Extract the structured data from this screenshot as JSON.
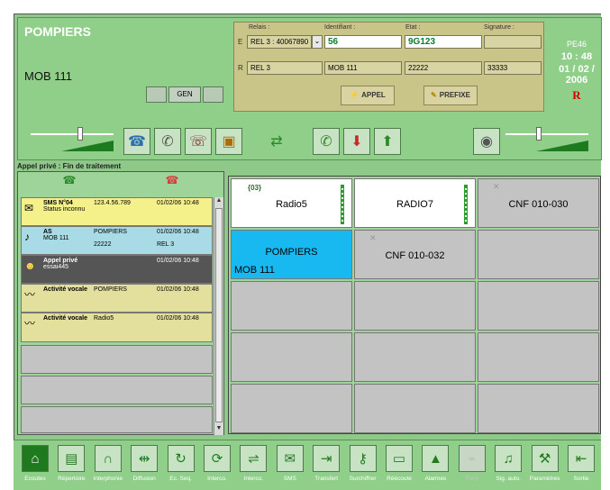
{
  "unit": {
    "title": "POMPIERS",
    "subtitle": "MOB 111",
    "gen_label": "GEN"
  },
  "relay": {
    "headers": {
      "relais": "Relais :",
      "identifiant": "Identifiant :",
      "etat": "Etat :",
      "signature": "Signature :"
    },
    "row_e": {
      "prefix": "E",
      "relais": "REL 3 : 40067890",
      "identifiant": "56",
      "etat": "9G123",
      "signature": ""
    },
    "row_r": {
      "prefix": "R",
      "relais": "REL 3",
      "identifiant": "MOB 111",
      "etat": "22222",
      "signature": "33333"
    },
    "appel_label": "APPEL",
    "prefixe_label": "PREFIXE"
  },
  "status": {
    "pe": "PE46",
    "time": "10 : 48",
    "date": "01 / 02 / 2006",
    "mark": "R"
  },
  "status_line": "Appel privé : Fin de traitement",
  "list": {
    "rows": [
      {
        "icon": "envelope-icon",
        "c1": "SMS N°04",
        "c1b": "Status inconnu",
        "c2": "123.4.56.789",
        "c3": "01/02/06 10:48",
        "bg": "#f4f08a"
      },
      {
        "icon": "music-note-icon",
        "c1": "AS",
        "c1b": "MOB 111",
        "c2": "POMPIERS",
        "c2b": "22222",
        "c3": "01/02/06 10:48",
        "c3b": "REL 3",
        "bg": "#a9dbe6"
      },
      {
        "icon": "private-call-icon",
        "c1": "Appel privé",
        "c1b": "essai445",
        "c2": "",
        "c3": "01/02/06 10:48",
        "bg": "#555555"
      },
      {
        "icon": "voice-wave-icon",
        "c1": "Activité vocale",
        "c2": "POMPIERS",
        "c3": "01/02/06 10:48",
        "bg": "#e3df9d"
      },
      {
        "icon": "voice-wave-icon",
        "c1": "Activité vocale",
        "c2": "Radio5",
        "c3": "01/02/06 10:48",
        "bg": "#e3df9d"
      }
    ]
  },
  "grid": {
    "cells": [
      {
        "name": "Radio5",
        "tag": "{03}",
        "style": "white",
        "level": true
      },
      {
        "name": "RADIO7",
        "style": "white",
        "level": true
      },
      {
        "name": "CNF 010-030",
        "style": "grey",
        "crossed": true
      },
      {
        "name": "POMPIERS",
        "sub": "MOB 111",
        "style": "cyan"
      },
      {
        "name": "CNF 010-032",
        "style": "grey",
        "crossed": true
      },
      {
        "name": "",
        "style": "grey"
      },
      {
        "name": "",
        "style": "grey"
      },
      {
        "name": "",
        "style": "grey"
      },
      {
        "name": "",
        "style": "grey"
      },
      {
        "name": "",
        "style": "grey"
      },
      {
        "name": "",
        "style": "grey"
      },
      {
        "name": "",
        "style": "grey"
      },
      {
        "name": "",
        "style": "grey"
      },
      {
        "name": "",
        "style": "grey"
      },
      {
        "name": "",
        "style": "grey"
      }
    ]
  },
  "toolbar": {
    "items": [
      {
        "label": "Ecoutes",
        "icon": "home-icon",
        "active": true
      },
      {
        "label": "Répertoire",
        "icon": "book-icon"
      },
      {
        "label": "Interphonie",
        "icon": "headset-icon"
      },
      {
        "label": "Diffusion",
        "icon": "broadcast-icon"
      },
      {
        "label": "Ec. Seq.",
        "icon": "cycle-icon"
      },
      {
        "label": "Interco.",
        "icon": "refresh-icon"
      },
      {
        "label": "Interco.",
        "icon": "interco-transfer-icon"
      },
      {
        "label": "SMS",
        "icon": "envelope-icon"
      },
      {
        "label": "Transfert",
        "icon": "transfer-icon"
      },
      {
        "label": "Surchiffrer",
        "icon": "keys-icon"
      },
      {
        "label": "Réécoute",
        "icon": "tape-icon"
      },
      {
        "label": "Alarmes",
        "icon": "warning-icon"
      },
      {
        "label": "Forçt",
        "icon": "force-icon",
        "disabled": true
      },
      {
        "label": "Sig. auto.",
        "icon": "music-note-icon"
      },
      {
        "label": "Paramètres",
        "icon": "tools-icon"
      },
      {
        "label": "Sortie",
        "icon": "exit-icon"
      }
    ]
  }
}
